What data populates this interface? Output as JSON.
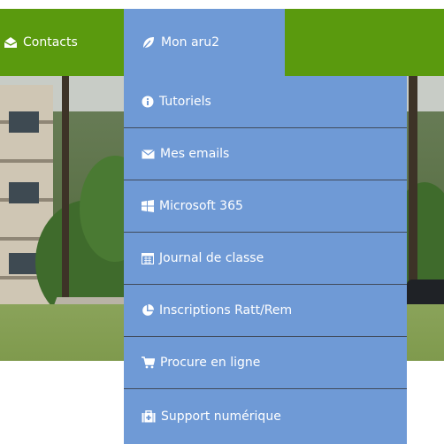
{
  "nav": {
    "contacts": {
      "label": "Contacts",
      "icon": "envelope-open-icon"
    },
    "mon_aru2": {
      "label": "Mon aru2",
      "icon": "leaf-icon"
    }
  },
  "menu": {
    "items": [
      {
        "label": "Tutoriels",
        "icon": "info-circle-icon"
      },
      {
        "label": "Mes emails",
        "icon": "envelope-icon"
      },
      {
        "label": "Microsoft 365",
        "icon": "windows-icon"
      },
      {
        "label": "Journal de classe",
        "icon": "calendar-icon"
      },
      {
        "label": "Inscriptions Ratt/Rem",
        "icon": "pie-chart-icon"
      },
      {
        "label": "Procure en ligne",
        "icon": "shopping-cart-icon"
      },
      {
        "label": "Support numérique",
        "icon": "medkit-icon"
      }
    ]
  },
  "colors": {
    "navbar_green": "#5a9a0e",
    "menu_blue": "#6f9ad6",
    "divider": "#404a5a",
    "text": "#ffffff"
  }
}
